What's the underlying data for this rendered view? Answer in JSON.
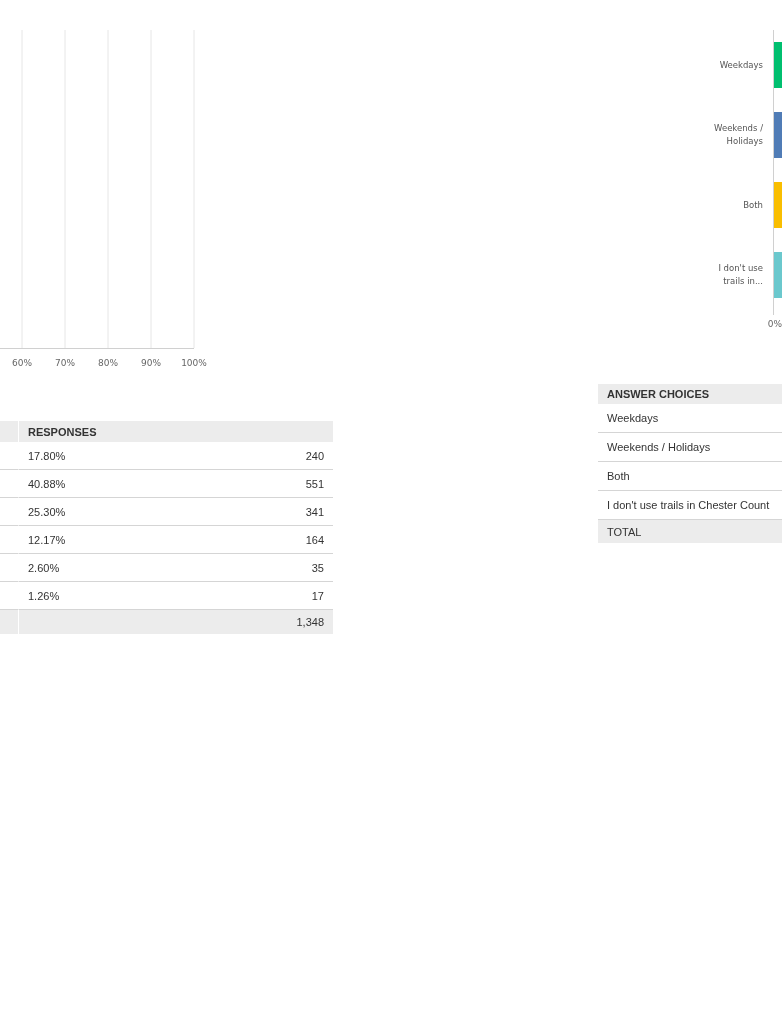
{
  "left_question": {
    "chart": {
      "axis_labels": [
        "60%",
        "70%",
        "80%",
        "90%",
        "100%"
      ]
    },
    "table": {
      "header": "RESPONSES",
      "rows": [
        {
          "percent": "17.80%",
          "count": "240"
        },
        {
          "percent": "40.88%",
          "count": "551"
        },
        {
          "percent": "25.30%",
          "count": "341"
        },
        {
          "percent": "12.17%",
          "count": "164"
        },
        {
          "percent": "2.60%",
          "count": "35"
        },
        {
          "percent": "1.26%",
          "count": "17"
        }
      ],
      "total_count": "1,348"
    }
  },
  "right_question": {
    "chart": {
      "categories": [
        "Weekdays",
        "Weekends / Holidays",
        "Both",
        "I don't use trails in..."
      ],
      "axis_labels": [
        "0%"
      ],
      "bars": [
        {
          "color": "#00bf6f"
        },
        {
          "color": "#507cb6"
        },
        {
          "color": "#f9be00"
        },
        {
          "color": "#6bc8cd"
        }
      ]
    },
    "table": {
      "header": "ANSWER CHOICES",
      "rows": [
        {
          "choice": "Weekdays"
        },
        {
          "choice": "Weekends / Holidays"
        },
        {
          "choice": "Both"
        },
        {
          "choice": "I don't use trails in Chester Count"
        }
      ],
      "total_label": "TOTAL"
    }
  }
}
